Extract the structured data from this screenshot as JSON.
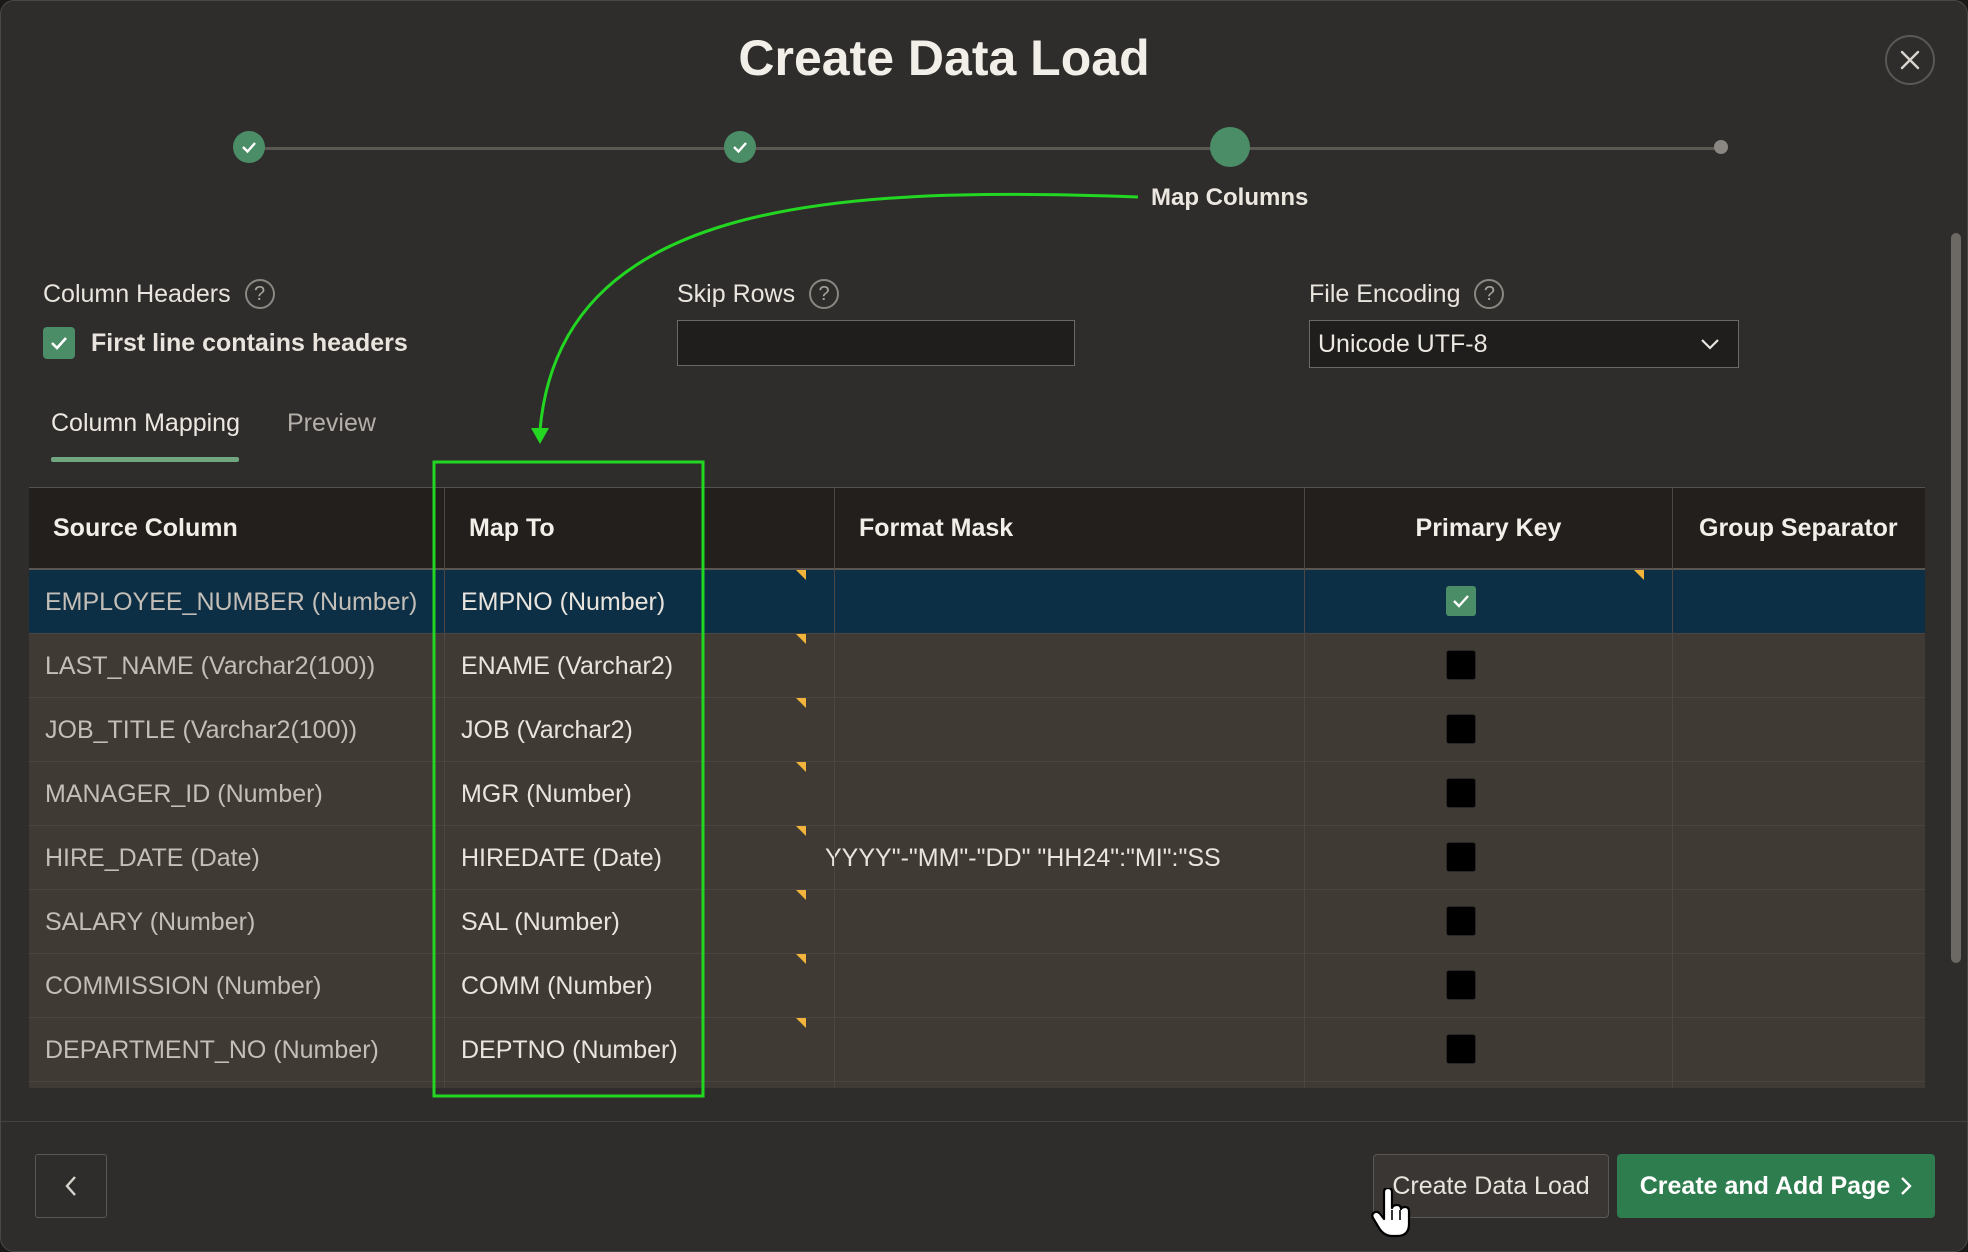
{
  "dialog": {
    "title": "Create Data Load",
    "close_icon": "close-icon"
  },
  "progress": {
    "steps_total": 4,
    "current_step": 3,
    "current_label": "Map Columns"
  },
  "form": {
    "column_headers_label": "Column Headers",
    "first_line_label": "First line contains headers",
    "first_line_checked": true,
    "skip_rows_label": "Skip Rows",
    "skip_rows_value": "",
    "file_encoding_label": "File Encoding",
    "file_encoding_value": "Unicode UTF-8"
  },
  "tabs": [
    {
      "label": "Column Mapping",
      "active": true
    },
    {
      "label": "Preview",
      "active": false
    }
  ],
  "grid": {
    "headers": {
      "source": "Source Column",
      "map_to": "Map To",
      "format": "Format Mask",
      "pk": "Primary Key",
      "group": "Group Separator"
    },
    "rows": [
      {
        "source": "EMPLOYEE_NUMBER (Number)",
        "map_to": "EMPNO (Number)",
        "format": "",
        "pk": true,
        "selected": true
      },
      {
        "source": "LAST_NAME (Varchar2(100))",
        "map_to": "ENAME (Varchar2)",
        "format": "",
        "pk": false,
        "selected": false
      },
      {
        "source": "JOB_TITLE (Varchar2(100))",
        "map_to": "JOB (Varchar2)",
        "format": "",
        "pk": false,
        "selected": false
      },
      {
        "source": "MANAGER_ID (Number)",
        "map_to": "MGR (Number)",
        "format": "",
        "pk": false,
        "selected": false
      },
      {
        "source": "HIRE_DATE (Date)",
        "map_to": "HIREDATE (Date)",
        "format": "YYYY\"-\"MM\"-\"DD\" \"HH24\":\"MI\":\"SS",
        "pk": false,
        "selected": false
      },
      {
        "source": "SALARY (Number)",
        "map_to": "SAL (Number)",
        "format": "",
        "pk": false,
        "selected": false
      },
      {
        "source": "COMMISSION (Number)",
        "map_to": "COMM (Number)",
        "format": "",
        "pk": false,
        "selected": false
      },
      {
        "source": "DEPARTMENT_NO (Number)",
        "map_to": "DEPTNO (Number)",
        "format": "",
        "pk": false,
        "selected": false
      }
    ]
  },
  "footer": {
    "back_icon": "chevron-left-icon",
    "create_label": "Create Data Load",
    "create_add_label": "Create and Add Page"
  },
  "colors": {
    "accent_green": "#4b8d67",
    "primary_button": "#2e7d4f",
    "selected_row": "#0d2f45",
    "annotation_green": "#22d622",
    "changed_marker": "#f1b33a"
  }
}
